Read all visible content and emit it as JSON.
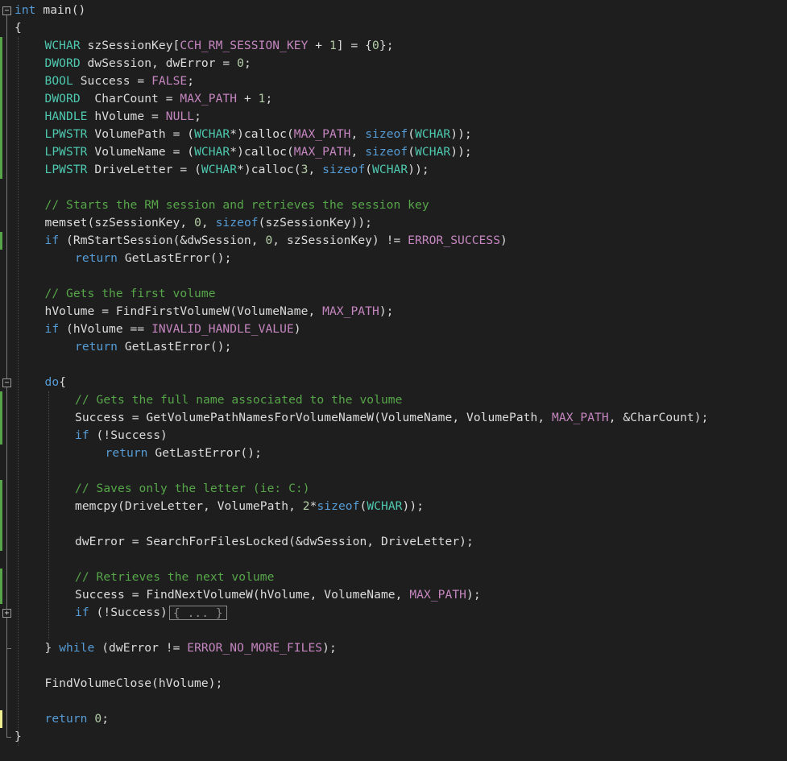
{
  "editor": {
    "fold_expanded_glyph": "−",
    "fold_collapsed_glyph": "+",
    "collapsed_placeholder": "{ ... }",
    "colors": {
      "background": "#1e1e1e",
      "keyword": "#569cd6",
      "type": "#4ec9b0",
      "macro": "#c586c0",
      "comment": "#57a64a",
      "number": "#b5cea8",
      "text": "#dcdcdc",
      "change_saved": "#57a64a",
      "change_unsaved": "#efef91"
    },
    "lines": [
      {
        "indent": 0,
        "tokens": [
          [
            "kw",
            "int"
          ],
          [
            "fn",
            " main"
          ],
          [
            "txt",
            "()"
          ]
        ]
      },
      {
        "indent": 0,
        "tokens": [
          [
            "txt",
            "{"
          ]
        ]
      },
      {
        "indent": 1,
        "tokens": [
          [
            "typ",
            "WCHAR"
          ],
          [
            "txt",
            " szSessionKey["
          ],
          [
            "mac",
            "CCH_RM_SESSION_KEY"
          ],
          [
            "txt",
            " + "
          ],
          [
            "num",
            "1"
          ],
          [
            "txt",
            "] = {"
          ],
          [
            "num",
            "0"
          ],
          [
            "txt",
            "};"
          ]
        ]
      },
      {
        "indent": 1,
        "tokens": [
          [
            "typ",
            "DWORD"
          ],
          [
            "txt",
            " dwSession, dwError = "
          ],
          [
            "num",
            "0"
          ],
          [
            "txt",
            ";"
          ]
        ]
      },
      {
        "indent": 1,
        "tokens": [
          [
            "typ",
            "BOOL"
          ],
          [
            "txt",
            " Success = "
          ],
          [
            "mac",
            "FALSE"
          ],
          [
            "txt",
            ";"
          ]
        ]
      },
      {
        "indent": 1,
        "tokens": [
          [
            "typ",
            "DWORD"
          ],
          [
            "txt",
            "  CharCount = "
          ],
          [
            "mac",
            "MAX_PATH"
          ],
          [
            "txt",
            " + "
          ],
          [
            "num",
            "1"
          ],
          [
            "txt",
            ";"
          ]
        ]
      },
      {
        "indent": 1,
        "tokens": [
          [
            "typ",
            "HANDLE"
          ],
          [
            "txt",
            " hVolume = "
          ],
          [
            "mac",
            "NULL"
          ],
          [
            "txt",
            ";"
          ]
        ]
      },
      {
        "indent": 1,
        "tokens": [
          [
            "typ",
            "LPWSTR"
          ],
          [
            "txt",
            " VolumePath = ("
          ],
          [
            "typ",
            "WCHAR"
          ],
          [
            "txt",
            "*)calloc("
          ],
          [
            "mac",
            "MAX_PATH"
          ],
          [
            "txt",
            ", "
          ],
          [
            "kw",
            "sizeof"
          ],
          [
            "txt",
            "("
          ],
          [
            "typ",
            "WCHAR"
          ],
          [
            "txt",
            "));"
          ]
        ]
      },
      {
        "indent": 1,
        "tokens": [
          [
            "typ",
            "LPWSTR"
          ],
          [
            "txt",
            " VolumeName = ("
          ],
          [
            "typ",
            "WCHAR"
          ],
          [
            "txt",
            "*)calloc("
          ],
          [
            "mac",
            "MAX_PATH"
          ],
          [
            "txt",
            ", "
          ],
          [
            "kw",
            "sizeof"
          ],
          [
            "txt",
            "("
          ],
          [
            "typ",
            "WCHAR"
          ],
          [
            "txt",
            "));"
          ]
        ]
      },
      {
        "indent": 1,
        "tokens": [
          [
            "typ",
            "LPWSTR"
          ],
          [
            "txt",
            " DriveLetter = ("
          ],
          [
            "typ",
            "WCHAR"
          ],
          [
            "txt",
            "*)calloc("
          ],
          [
            "num",
            "3"
          ],
          [
            "txt",
            ", "
          ],
          [
            "kw",
            "sizeof"
          ],
          [
            "txt",
            "("
          ],
          [
            "typ",
            "WCHAR"
          ],
          [
            "txt",
            "));"
          ]
        ]
      },
      {
        "indent": 1,
        "tokens": []
      },
      {
        "indent": 1,
        "tokens": [
          [
            "cmt",
            "// Starts the RM session and retrieves the session key"
          ]
        ]
      },
      {
        "indent": 1,
        "tokens": [
          [
            "txt",
            "memset(szSessionKey, "
          ],
          [
            "num",
            "0"
          ],
          [
            "txt",
            ", "
          ],
          [
            "kw",
            "sizeof"
          ],
          [
            "txt",
            "(szSessionKey));"
          ]
        ]
      },
      {
        "indent": 1,
        "tokens": [
          [
            "kw",
            "if"
          ],
          [
            "txt",
            " (RmStartSession(&dwSession, "
          ],
          [
            "num",
            "0"
          ],
          [
            "txt",
            ", szSessionKey) != "
          ],
          [
            "mac",
            "ERROR_SUCCESS"
          ],
          [
            "txt",
            ")"
          ]
        ]
      },
      {
        "indent": 2,
        "tokens": [
          [
            "kw",
            "return"
          ],
          [
            "txt",
            " GetLastError();"
          ]
        ]
      },
      {
        "indent": 1,
        "tokens": []
      },
      {
        "indent": 1,
        "tokens": [
          [
            "cmt",
            "// Gets the first volume"
          ]
        ]
      },
      {
        "indent": 1,
        "tokens": [
          [
            "txt",
            "hVolume = FindFirstVolumeW(VolumeName, "
          ],
          [
            "mac",
            "MAX_PATH"
          ],
          [
            "txt",
            ");"
          ]
        ]
      },
      {
        "indent": 1,
        "tokens": [
          [
            "kw",
            "if"
          ],
          [
            "txt",
            " (hVolume == "
          ],
          [
            "mac",
            "INVALID_HANDLE_VALUE"
          ],
          [
            "txt",
            ")"
          ]
        ]
      },
      {
        "indent": 2,
        "tokens": [
          [
            "kw",
            "return"
          ],
          [
            "txt",
            " GetLastError();"
          ]
        ]
      },
      {
        "indent": 1,
        "tokens": []
      },
      {
        "indent": 1,
        "tokens": [
          [
            "kw",
            "do"
          ],
          [
            "txt",
            "{"
          ]
        ]
      },
      {
        "indent": 2,
        "tokens": [
          [
            "cmt",
            "// Gets the full name associated to the volume"
          ]
        ]
      },
      {
        "indent": 2,
        "tokens": [
          [
            "txt",
            "Success = GetVolumePathNamesForVolumeNameW(VolumeName, VolumePath, "
          ],
          [
            "mac",
            "MAX_PATH"
          ],
          [
            "txt",
            ", &CharCount);"
          ]
        ]
      },
      {
        "indent": 2,
        "tokens": [
          [
            "kw",
            "if"
          ],
          [
            "txt",
            " (!Success)"
          ]
        ]
      },
      {
        "indent": 3,
        "tokens": [
          [
            "kw",
            "return"
          ],
          [
            "txt",
            " GetLastError();"
          ]
        ]
      },
      {
        "indent": 2,
        "tokens": []
      },
      {
        "indent": 2,
        "tokens": [
          [
            "cmt",
            "// Saves only the letter (ie: C:)"
          ]
        ]
      },
      {
        "indent": 2,
        "tokens": [
          [
            "txt",
            "memcpy(DriveLetter, VolumePath, "
          ],
          [
            "num",
            "2"
          ],
          [
            "txt",
            "*"
          ],
          [
            "kw",
            "sizeof"
          ],
          [
            "txt",
            "("
          ],
          [
            "typ",
            "WCHAR"
          ],
          [
            "txt",
            "));"
          ]
        ]
      },
      {
        "indent": 2,
        "tokens": []
      },
      {
        "indent": 2,
        "tokens": [
          [
            "txt",
            "dwError = SearchForFilesLocked(&dwSession, DriveLetter);"
          ]
        ]
      },
      {
        "indent": 2,
        "tokens": []
      },
      {
        "indent": 2,
        "tokens": [
          [
            "cmt",
            "// Retrieves the next volume"
          ]
        ]
      },
      {
        "indent": 2,
        "tokens": [
          [
            "txt",
            "Success = FindNextVolumeW(hVolume, VolumeName, "
          ],
          [
            "mac",
            "MAX_PATH"
          ],
          [
            "txt",
            ");"
          ]
        ]
      },
      {
        "indent": 2,
        "tokens": [
          [
            "kw",
            "if"
          ],
          [
            "txt",
            " (!Success)"
          ]
        ],
        "collapsed": true
      },
      {
        "indent": 2,
        "tokens": []
      },
      {
        "indent": 1,
        "tokens": [
          [
            "txt",
            "} "
          ],
          [
            "kw",
            "while"
          ],
          [
            "txt",
            " (dwError != "
          ],
          [
            "mac",
            "ERROR_NO_MORE_FILES"
          ],
          [
            "txt",
            ");"
          ]
        ]
      },
      {
        "indent": 1,
        "tokens": []
      },
      {
        "indent": 1,
        "tokens": [
          [
            "txt",
            "FindVolumeClose(hVolume);"
          ]
        ]
      },
      {
        "indent": 1,
        "tokens": []
      },
      {
        "indent": 1,
        "tokens": [
          [
            "kw",
            "return"
          ],
          [
            "txt",
            " "
          ],
          [
            "num",
            "0"
          ],
          [
            "txt",
            ";"
          ]
        ]
      },
      {
        "indent": 0,
        "tokens": [
          [
            "txt",
            "}"
          ]
        ]
      }
    ]
  }
}
